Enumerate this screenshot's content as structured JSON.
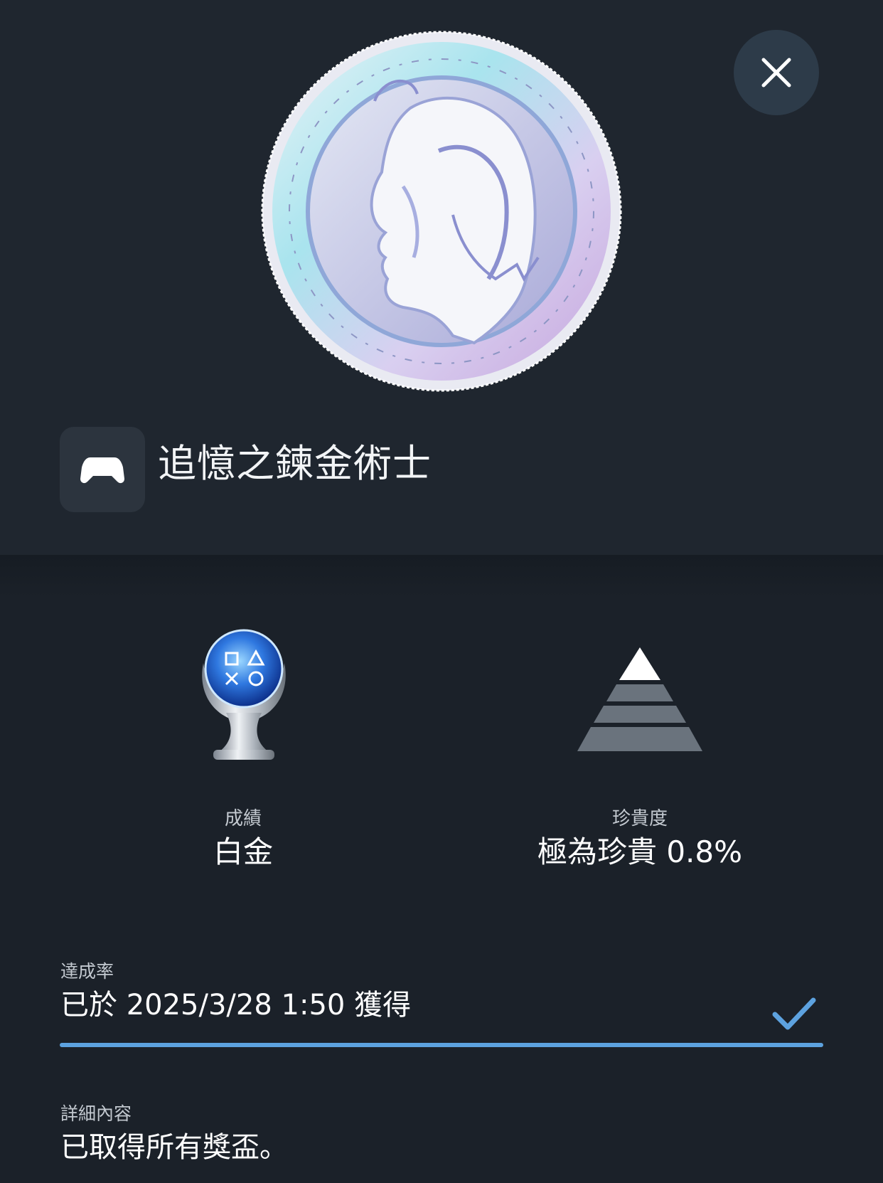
{
  "game": {
    "title": "追憶之鍊金術士",
    "icon": "gamepad-icon"
  },
  "trophy_image": "coin-medal-portrait",
  "close": {
    "icon": "close-icon"
  },
  "grade": {
    "label": "成績",
    "value": "白金",
    "icon": "platinum-trophy-icon"
  },
  "rarity": {
    "label": "珍貴度",
    "value": "極為珍貴 0.8%",
    "icon": "rarity-pyramid-icon",
    "percent": 0.8
  },
  "achievement": {
    "label": "達成率",
    "value": "已於 2025/3/28  1:50 獲得",
    "progress": 1.0,
    "icon": "check-icon"
  },
  "details": {
    "label": "詳細內容",
    "value": "已取得所有獎盃。"
  },
  "colors": {
    "background": "#1b2129",
    "panel": "#1f262f",
    "accent": "#5da2df",
    "close_bg": "#2d3b49"
  }
}
